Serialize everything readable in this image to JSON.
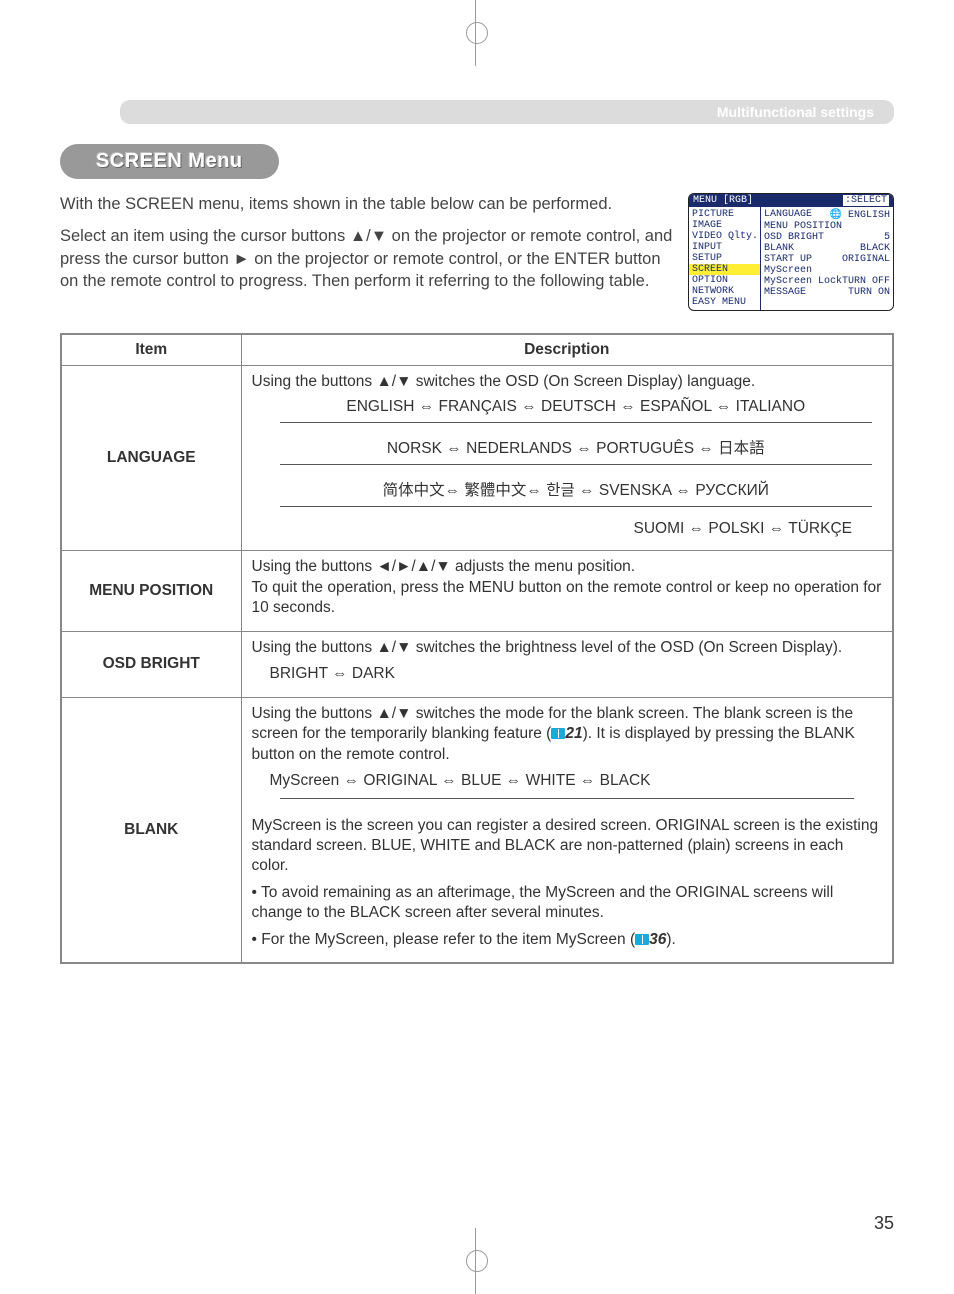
{
  "header": {
    "breadcrumb": "Multifunctional settings"
  },
  "section_title": "SCREEN Menu",
  "intro": {
    "p1": "With the SCREEN menu, items shown in the table below can be performed.",
    "p2": "Select an item using the cursor buttons ▲/▼ on the projector or remote control, and press the cursor button ► on the projector or remote control, or the ENTER button on the remote control to progress. Then perform it referring to the following table."
  },
  "osd": {
    "title_left": "MENU [RGB]",
    "title_right": ":SELECT",
    "left_items": [
      "PICTURE",
      "IMAGE",
      "VIDEO Qlty.",
      "INPUT",
      "SETUP",
      "SCREEN",
      "OPTION",
      "NETWORK",
      "EASY MENU"
    ],
    "highlight": "SCREEN",
    "right_rows": [
      {
        "l": "LANGUAGE",
        "r": "🌐 ENGLISH"
      },
      {
        "l": "MENU POSITION",
        "r": ""
      },
      {
        "l": "OSD BRIGHT",
        "r": "5"
      },
      {
        "l": "BLANK",
        "r": "BLACK"
      },
      {
        "l": "START UP",
        "r": "ORIGINAL"
      },
      {
        "l": "MyScreen",
        "r": ""
      },
      {
        "l": "MyScreen Lock",
        "r": "TURN OFF"
      },
      {
        "l": "MESSAGE",
        "r": "TURN ON"
      }
    ]
  },
  "table": {
    "head_item": "Item",
    "head_desc": "Description",
    "rows": [
      {
        "item": "LANGUAGE",
        "desc_intro": "Using the buttons ▲/▼ switches the OSD (On Screen Display) language.",
        "lang_lines": [
          "ENGLISH ⇔ FRANÇAIS ⇔ DEUTSCH ⇔ ESPAÑOL ⇔ ITALIANO",
          "NORSK ⇔ NEDERLANDS ⇔ PORTUGUÊS ⇔ 日本語",
          "简体中文⇔ 繁體中文⇔ 한글 ⇔ SVENSKA ⇔ РУССКИЙ",
          "SUOMI ⇔ POLSKI ⇔ TÜRKÇE"
        ]
      },
      {
        "item": "MENU POSITION",
        "desc": "Using the buttons ◄/►/▲/▼ adjusts the menu position.\nTo quit the operation, press the MENU button on the remote control or keep no operation for 10 seconds."
      },
      {
        "item": "OSD BRIGHT",
        "desc_intro": "Using the buttons ▲/▼ switches the brightness level of the OSD (On Screen Display).",
        "options": "BRIGHT ⇔ DARK"
      },
      {
        "item": "BLANK",
        "p1": "Using the buttons ▲/▼ switches the mode for the blank screen. The blank screen is the screen for the temporarily blanking feature (",
        "p1_ref": "21",
        "p1_tail": "). It is displayed by pressing the BLANK button on the remote control.",
        "options": "MyScreen ⇔ ORIGINAL ⇔ BLUE ⇔ WHITE ⇔ BLACK",
        "p2": "MyScreen is the screen you can register a desired screen. ORIGINAL screen is the existing standard screen. BLUE, WHITE and BLACK are non-patterned (plain) screens in each color.",
        "bullet1": "• To avoid remaining as an afterimage, the MyScreen and the ORIGINAL screens will change to the BLACK screen after several minutes.",
        "bullet2_a": "• For the MyScreen, please refer to the item MyScreen (",
        "bullet2_ref": "36",
        "bullet2_b": ")."
      }
    ]
  },
  "page_number": "35"
}
